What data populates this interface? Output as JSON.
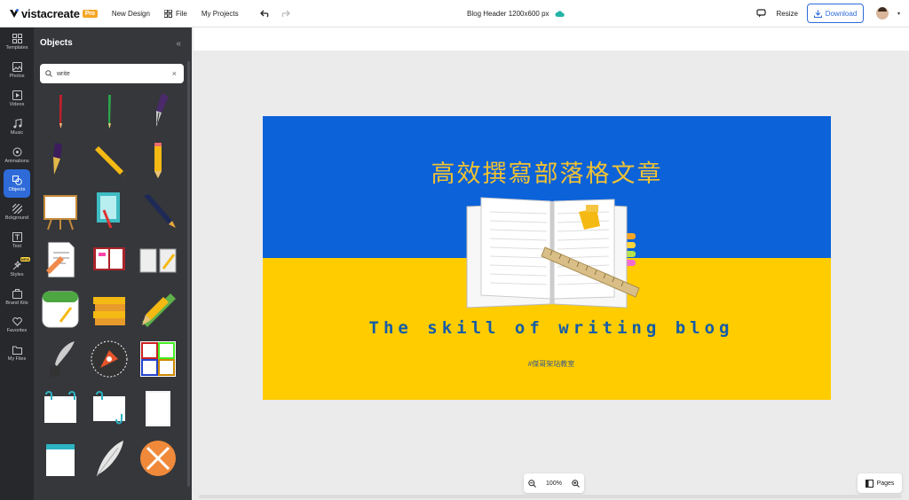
{
  "topbar": {
    "logo_text": "vistacreate",
    "pro_badge": "Pro",
    "new_design": "New Design",
    "file": "File",
    "my_projects": "My Projects",
    "doc_title": "Blog Header 1200x600 px",
    "resize": "Resize",
    "download": "Download"
  },
  "rail": {
    "items": [
      {
        "label": "Templates",
        "icon": "templates-icon"
      },
      {
        "label": "Photos",
        "icon": "photos-icon"
      },
      {
        "label": "Videos",
        "icon": "videos-icon"
      },
      {
        "label": "Music",
        "icon": "music-icon"
      },
      {
        "label": "Animations",
        "icon": "animations-icon"
      },
      {
        "label": "Objects",
        "icon": "objects-icon"
      },
      {
        "label": "Bckground",
        "icon": "background-icon"
      },
      {
        "label": "Text",
        "icon": "text-icon"
      },
      {
        "label": "Styles",
        "icon": "styles-icon"
      },
      {
        "label": "Brand Kits",
        "icon": "brand-kits-icon"
      },
      {
        "label": "Favorites",
        "icon": "heart-icon"
      },
      {
        "label": "My Files",
        "icon": "folder-icon"
      }
    ],
    "active": "Objects",
    "new_badge": "NEW"
  },
  "panel": {
    "title": "Objects",
    "search_value": "write"
  },
  "canvas": {
    "title_cn": "高效撰寫部落格文章",
    "subtitle_en": "The skill of writing blog",
    "hashtag": "#傑哥架站教室",
    "colors": {
      "top": "#0b62d9",
      "bottom": "#ffcc00",
      "title": "#f1c232",
      "subtitle": "#155ca7"
    }
  },
  "zoom": {
    "level": "100%"
  },
  "pages": {
    "label": "Pages"
  }
}
